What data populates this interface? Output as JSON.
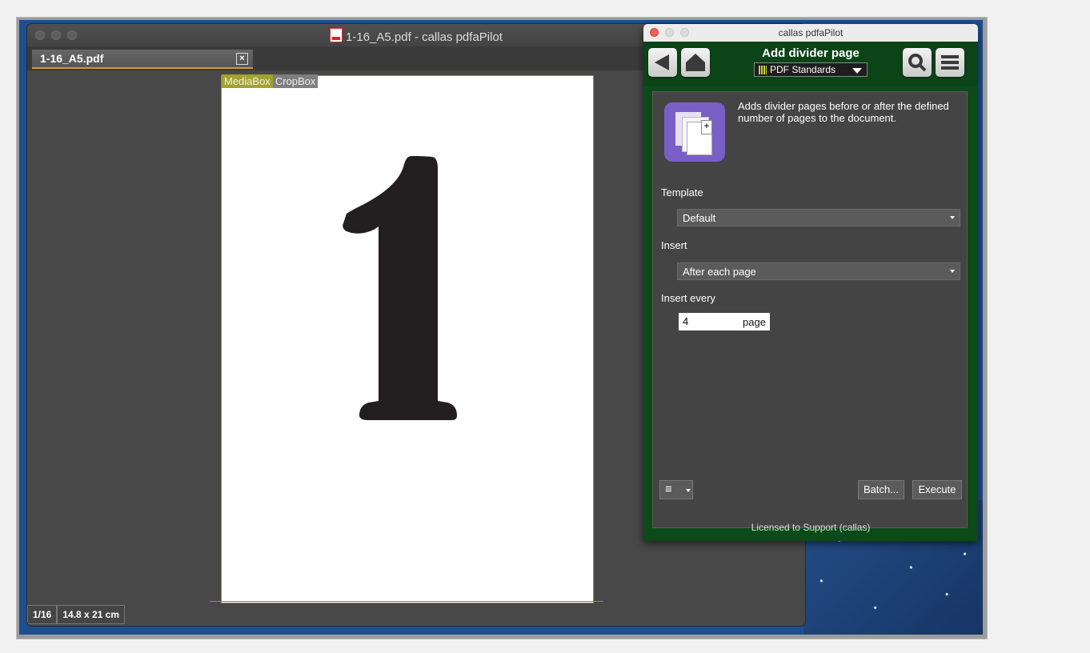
{
  "main_window": {
    "title": "1-16_A5.pdf - callas pdfaPilot",
    "tab_label": "1-16_A5.pdf",
    "tab_close": "×",
    "box_labels": {
      "media": "MediaBox",
      "crop": "CropBox"
    },
    "page_content": "1",
    "status": {
      "page": "1/16",
      "size": "14.8 x 21 cm"
    }
  },
  "panel": {
    "window_title": "callas pdfaPilot",
    "heading": "Add divider page",
    "standards_label": "PDF Standards",
    "description": "Adds divider pages before or after the defined number of pages to the document.",
    "template_label": "Template",
    "template_value": "Default",
    "insert_label": "Insert",
    "insert_value": "After each page",
    "insert_every_label": "Insert every",
    "insert_every_value": "4",
    "insert_every_unit": "page",
    "menu_glyph": "≡",
    "batch_label": "Batch...",
    "execute_label": "Execute",
    "license": "Licensed to Support (callas)"
  },
  "colors": {
    "panel_green": "#0d4a1a",
    "mediabox": "#a3a22c",
    "cropbox": "#7e7e7e",
    "tab_accent": "#d39b2a"
  },
  "icons": [
    "pdf-file-icon",
    "back-icon",
    "home-icon",
    "search-icon",
    "hamburger-icon",
    "divider-page-icon"
  ]
}
